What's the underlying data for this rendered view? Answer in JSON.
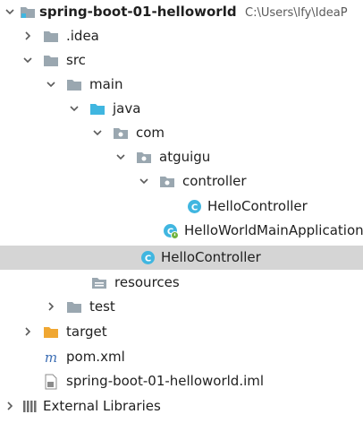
{
  "project": {
    "name": "spring-boot-01-helloworld",
    "path": "C:\\Users\\lfy\\IdeaP"
  },
  "tree": {
    "idea": ".idea",
    "src": "src",
    "main": "main",
    "java": "java",
    "com": "com",
    "atguigu": "atguigu",
    "controller": "controller",
    "hello_controller_inner": "HelloController",
    "main_application": "HelloWorldMainApplication",
    "hello_controller_outer": "HelloController",
    "resources": "resources",
    "test": "test",
    "target": "target",
    "pom": "pom.xml",
    "iml": "spring-boot-01-helloworld.iml",
    "external_libraries": "External Libraries"
  },
  "colors": {
    "folder_gray": "#9aa7b0",
    "source_folder_blue": "#40b6e0",
    "excluded_folder_orange": "#f0a732",
    "class_icon_blue": "#40b6e0",
    "selection": "#d5d5d5"
  },
  "icons": {
    "arrow_expanded": "chevron-down-icon",
    "arrow_collapsed": "chevron-right-icon",
    "folder": "folder-icon",
    "source_folder": "source-folder-icon",
    "package": "package-icon",
    "class": "class-icon",
    "spring_boot_class": "spring-boot-class-icon",
    "maven_file": "maven-file-icon",
    "module_file": "module-file-icon",
    "libraries": "libraries-icon"
  }
}
